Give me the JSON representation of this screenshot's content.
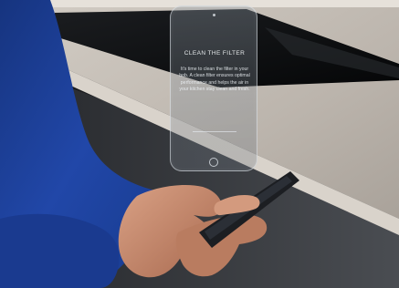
{
  "overlay": {
    "title": "CLEAN THE FILTER",
    "message": "It's time to clean the filter in your hob. A clean filter ensures optimal performance and helps the air in your kitchen stay clean and fresh."
  },
  "colors": {
    "sweater": "#1d3f9c",
    "skin": "#c98d6f",
    "countertop": "#bdb6ae",
    "hob_glass": "#0d0e10",
    "cabinet": "#3a3d42",
    "phone": "#1c1e22"
  }
}
